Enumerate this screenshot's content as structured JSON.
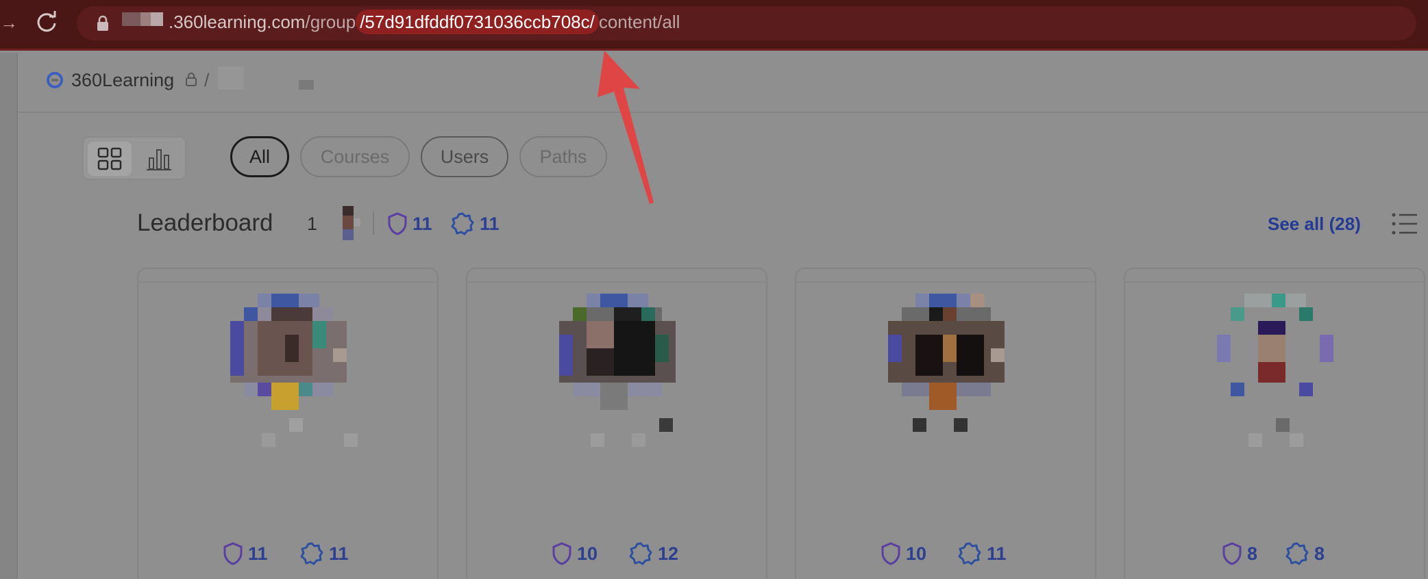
{
  "browser": {
    "url_domain": ".360learning.com",
    "url_path_prefix": "/group",
    "url_highlight": "/57d91dfddf0731036ccb708c/",
    "url_path_suffix": "content/all"
  },
  "breadcrumb": {
    "root": "360Learning",
    "separator": "/"
  },
  "filters": [
    {
      "label": "All",
      "state": "active"
    },
    {
      "label": "Courses",
      "state": "inactive"
    },
    {
      "label": "Users",
      "state": "inactive"
    },
    {
      "label": "Paths",
      "state": "inactive"
    }
  ],
  "leaderboard": {
    "title": "Leaderboard",
    "rank": "1",
    "shield_count": "11",
    "badge_count": "11",
    "see_all": "See all (28)"
  },
  "cards": [
    {
      "shield": "11",
      "badge": "11"
    },
    {
      "shield": "10",
      "badge": "12"
    },
    {
      "shield": "10",
      "badge": "11"
    },
    {
      "shield": "8",
      "badge": "8"
    }
  ],
  "colors": {
    "accent_blue": "#2d3f8f",
    "annotation_red": "#e04545",
    "urlbar_highlight": "#8f2020"
  }
}
